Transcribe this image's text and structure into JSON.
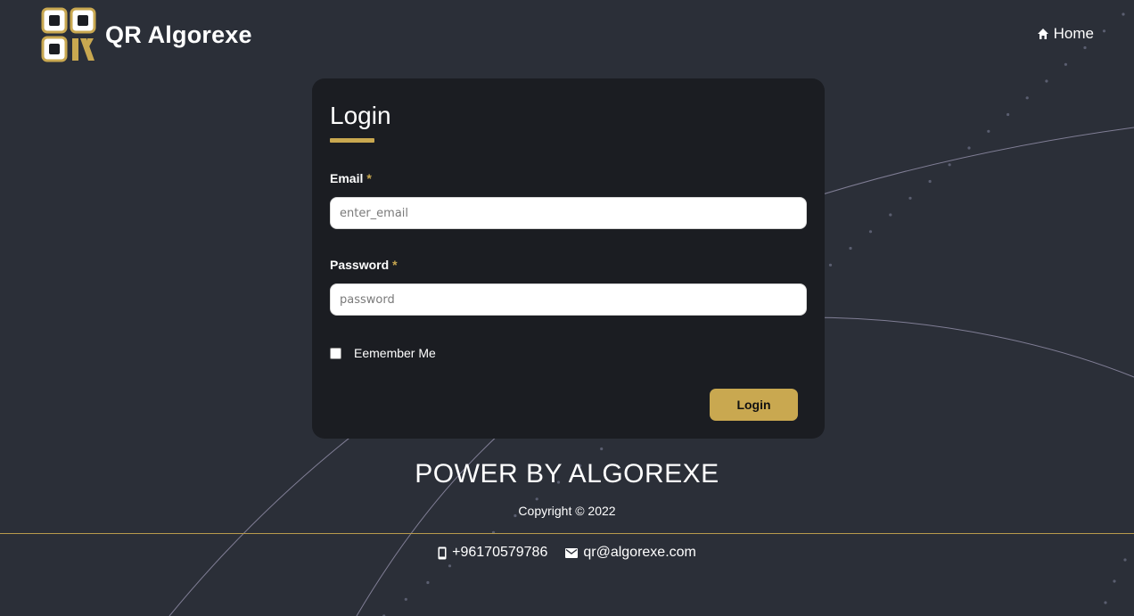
{
  "brand": {
    "name": "QR Algorexe",
    "logo_icon": "qr-logo-icon"
  },
  "nav": {
    "home_label": "Home",
    "home_icon": "home-icon"
  },
  "login_card": {
    "title": "Login",
    "email": {
      "label": "Email",
      "required_mark": "*",
      "placeholder": "enter_email",
      "value": ""
    },
    "password": {
      "label": "Password",
      "required_mark": "*",
      "placeholder": "password",
      "value": ""
    },
    "remember": {
      "label": "Eemember Me",
      "checked": false
    },
    "submit_label": "Login"
  },
  "footer": {
    "power_text": "POWER BY ALGOREXE",
    "copyright": "Copyright © 2022",
    "phone": "+96170579786",
    "phone_icon": "mobile-phone-icon",
    "email": "qr@algorexe.com",
    "email_icon": "mail-icon"
  },
  "colors": {
    "background": "#2b2f38",
    "card": "#1b1d22",
    "accent": "#c9a850",
    "text": "#ffffff"
  }
}
